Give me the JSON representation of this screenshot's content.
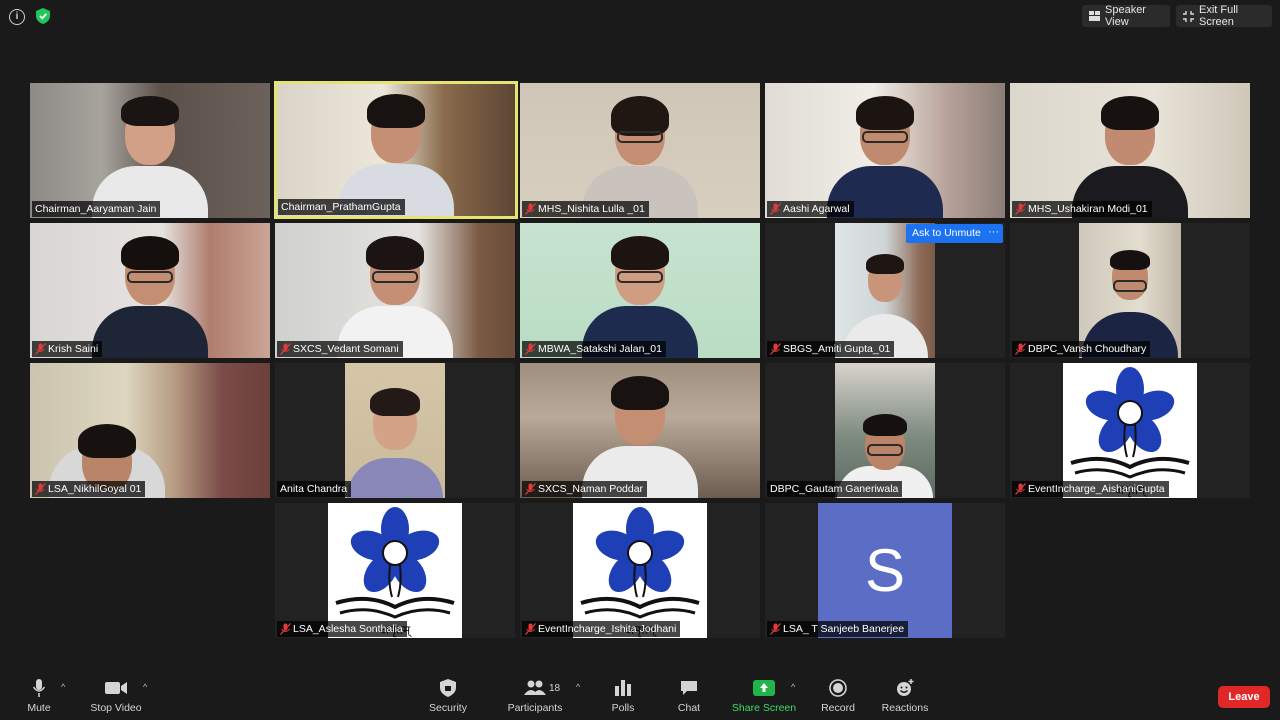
{
  "topbar": {
    "speaker_view": "Speaker View",
    "exit_full_screen": "Exit Full Screen"
  },
  "tiles": [
    {
      "name": "Chairman_Aaryaman Jain",
      "muted": false
    },
    {
      "name": "Chairman_PrathamGupta",
      "muted": false,
      "active_speaker": true
    },
    {
      "name": "MHS_Nishita Lulla _01",
      "muted": true
    },
    {
      "name": "Aashi Agarwal",
      "muted": true
    },
    {
      "name": "MHS_Ushakiran Modi_01",
      "muted": true
    },
    {
      "name": "Krish Saini",
      "muted": true
    },
    {
      "name": "SXCS_Vedant Somani",
      "muted": true
    },
    {
      "name": "MBWA_Satakshi Jalan_01",
      "muted": true
    },
    {
      "name": "SBGS_Amiti Gupta_01",
      "muted": true
    },
    {
      "name": "DBPC_Vansh Choudhary",
      "muted": true
    },
    {
      "name": "LSA_NikhilGoyal 01",
      "muted": true
    },
    {
      "name": "Anita Chandra",
      "muted": false
    },
    {
      "name": "SXCS_Naman Poddar",
      "muted": true
    },
    {
      "name": "DBPC_Gautam Ganeriwala",
      "muted": false
    },
    {
      "name": "EventIncharge_AishaniGupta",
      "muted": true
    },
    {
      "name": "LSA_Aslesha Sonthalia",
      "muted": true
    },
    {
      "name": "EventIncharge_Ishita Jodhani",
      "muted": true
    },
    {
      "name": "LSA_ T Sanjeeb Banerjee",
      "muted": true
    }
  ],
  "avatar_letter": "S",
  "logo_text": "अमृतम्",
  "ask_to_unmute": "Ask to Unmute",
  "more_label": "···",
  "toolbar": {
    "mute": "Mute",
    "stop_video": "Stop Video",
    "security": "Security",
    "participants": "Participants",
    "participant_count": "18",
    "polls": "Polls",
    "chat": "Chat",
    "share_screen": "Share Screen",
    "record": "Record",
    "reactions": "Reactions",
    "leave": "Leave"
  },
  "colors": {
    "active_speaker_border": "#e5e373",
    "share_green": "#20b44a",
    "leave_red": "#e02828",
    "unmute_blue": "#1d72f2",
    "avatar_purple": "#5b6dc5",
    "logo_blue": "#1e3fb5"
  }
}
